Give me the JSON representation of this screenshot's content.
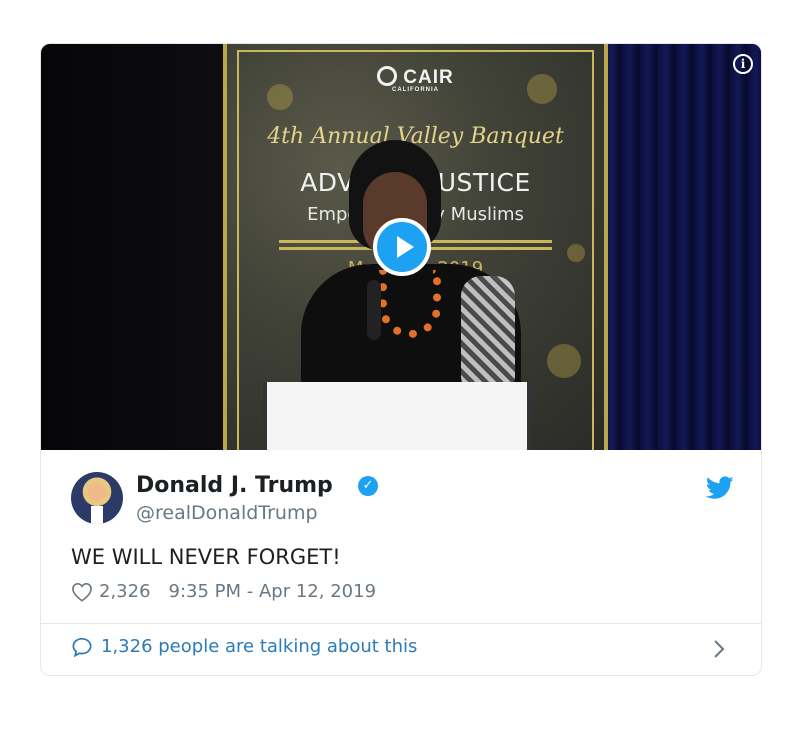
{
  "media": {
    "banner_brand": "CAIR",
    "banner_brand_sub": "CALIFORNIA",
    "banner_script": "4th Annual Valley Banquet",
    "banner_line1": "ADVA       JUSTICE",
    "banner_line2": "Empow       lley Muslims",
    "banner_date": "Ma           2019",
    "play_icon": "play-icon",
    "info_icon": "info-icon"
  },
  "tweet": {
    "author_name": "Donald J. Trump",
    "author_handle": "@realDonaldTrump",
    "verified_icon": "verified-badge-icon",
    "brand_icon": "twitter-bird-icon",
    "text": "WE WILL NEVER FORGET!",
    "likes": "2,326",
    "timestamp": "9:35 PM - Apr 12, 2019",
    "talking": "1,326 people are talking about this"
  },
  "colors": {
    "accent": "#1da1f2",
    "link": "#2b7bb9",
    "muted": "#697882",
    "text": "#1c2022"
  }
}
